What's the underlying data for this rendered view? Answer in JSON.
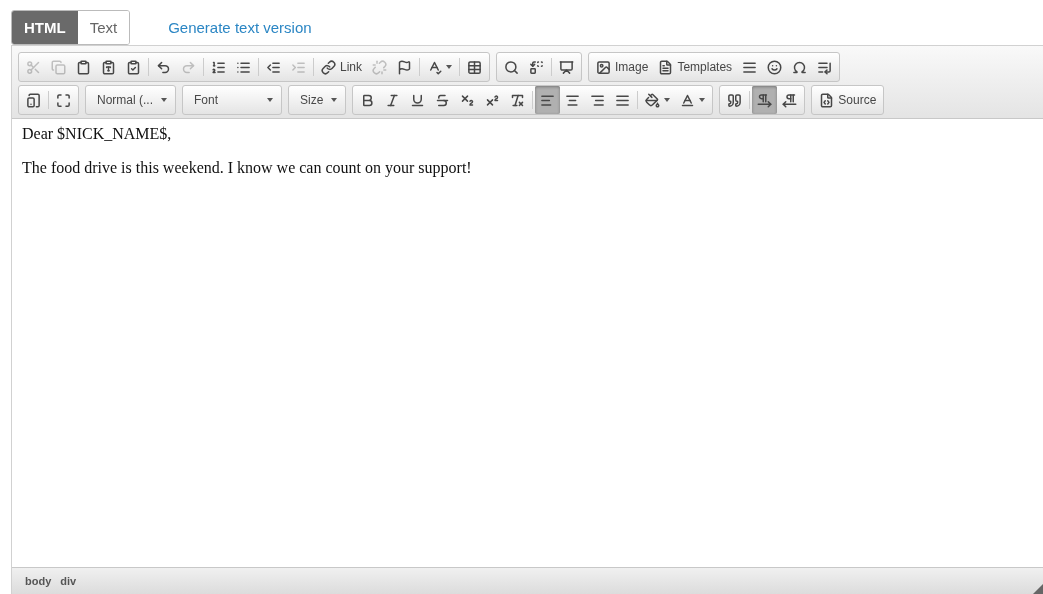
{
  "mode_tabs": [
    {
      "label": "HTML",
      "selected": true
    },
    {
      "label": "Text",
      "selected": false
    }
  ],
  "generate_link": "Generate text version",
  "toolbar": {
    "rows": [
      [
        {
          "kind": "group",
          "sections": [
            [
              {
                "disabled": true
              },
              {
                "disabled": true
              },
              {
                "disabled": false
              },
              {
                "disabled": false
              },
              {
                "disabled": false
              }
            ],
            [
              {
                "disabled": false
              },
              {
                "disabled": true
              }
            ],
            [
              {
                "disabled": false
              },
              {
                "disabled": false
              }
            ],
            [
              {
                "disabled": false
              },
              {
                "disabled": true
              }
            ],
            [
              {
                "disabled": false,
                "label": "Link"
              },
              {
                "disabled": true
              },
              {
                "disabled": false
              }
            ],
            [
              {
                "disabled": false,
                "dropdown": true
              }
            ],
            [
              {
                "disabled": false
              }
            ]
          ]
        },
        {
          "kind": "group",
          "sections": [
            [
              {
                "disabled": false
              },
              {
                "disabled": false
              }
            ],
            [
              {
                "disabled": false
              }
            ]
          ]
        },
        {
          "kind": "group",
          "sections": [
            [
              {
                "disabled": false,
                "label": "Image"
              },
              {
                "disabled": false,
                "label": "Templates"
              },
              {
                "disabled": false
              },
              {
                "disabled": false
              },
              {
                "disabled": false
              },
              {
                "disabled": false
              }
            ]
          ]
        }
      ],
      [
        {
          "kind": "group",
          "sections": [
            [
              {
                "disabled": false
              }
            ],
            [
              {
                "disabled": false
              }
            ]
          ]
        },
        {
          "kind": "combo",
          "label": "Normal (..."
        },
        {
          "kind": "combo",
          "label": "Font",
          "wide": true
        },
        {
          "kind": "combo",
          "label": "Size"
        },
        {
          "kind": "group",
          "sections": [
            [
              {
                "disabled": false
              },
              {
                "disabled": false
              },
              {
                "disabled": false
              },
              {
                "disabled": false
              },
              {
                "disabled": false
              },
              {
                "disabled": false
              },
              {
                "disabled": false
              }
            ],
            [
              {
                "disabled": false,
                "selected": true
              },
              {
                "disabled": false,
                "selected": false
              },
              {
                "disabled": false,
                "selected": false
              },
              {
                "disabled": false,
                "selected": false
              }
            ],
            [
              {
                "disabled": false,
                "dropdown": true
              },
              {
                "disabled": false,
                "dropdown": true
              }
            ]
          ]
        },
        {
          "kind": "group",
          "sections": [
            [
              {
                "disabled": false
              }
            ],
            [
              {
                "disabled": false,
                "selected": true
              },
              {
                "disabled": false,
                "selected": false
              }
            ]
          ]
        },
        {
          "kind": "group",
          "sections": [
            [
              {
                "disabled": false,
                "label": "Source"
              }
            ]
          ]
        }
      ]
    ]
  },
  "content": {
    "paragraphs": [
      "Dear $NICK_NAME$,",
      "The food drive is this weekend. I know we can count on your support!"
    ]
  },
  "path": [
    "body",
    "div"
  ]
}
